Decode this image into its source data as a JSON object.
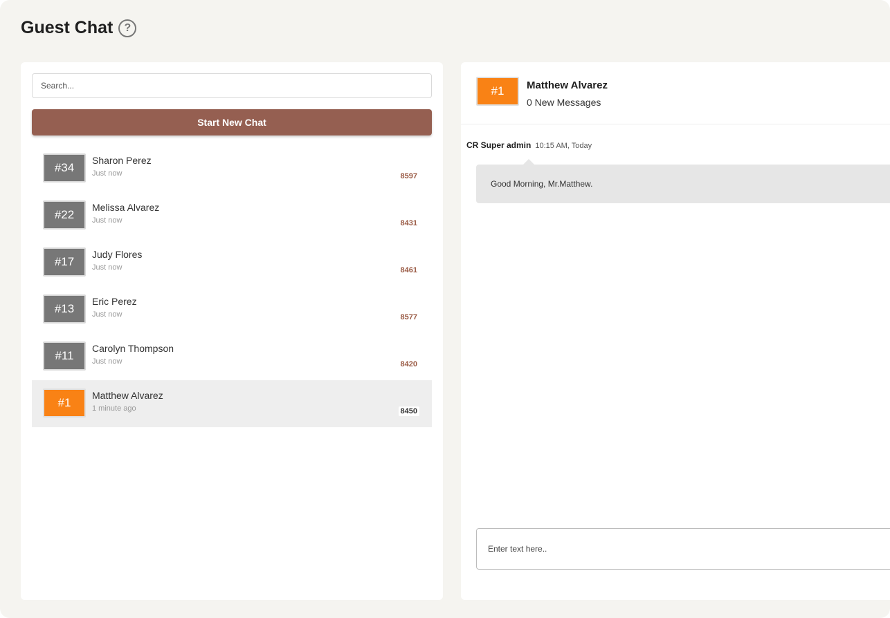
{
  "page": {
    "title": "Guest Chat",
    "help_icon": "question-circle-icon"
  },
  "sidebar": {
    "search_placeholder": "Search...",
    "new_chat_label": "Start New Chat",
    "chats": [
      {
        "room": "#34",
        "name": "Sharon Perez",
        "time": "Just now",
        "code": "8597",
        "active": false
      },
      {
        "room": "#22",
        "name": "Melissa Alvarez",
        "time": "Just now",
        "code": "8431",
        "active": false
      },
      {
        "room": "#17",
        "name": "Judy Flores",
        "time": "Just now",
        "code": "8461",
        "active": false
      },
      {
        "room": "#13",
        "name": "Eric Perez",
        "time": "Just now",
        "code": "8577",
        "active": false
      },
      {
        "room": "#11",
        "name": "Carolyn Thompson",
        "time": "Just now",
        "code": "8420",
        "active": false
      },
      {
        "room": "#1",
        "name": "Matthew Alvarez",
        "time": "1 minute ago",
        "code": "8450",
        "active": true
      }
    ]
  },
  "conversation": {
    "room": "#1",
    "name": "Matthew Alvarez",
    "new_messages": "0 New Messages",
    "messages": [
      {
        "sender": "CR Super admin",
        "time": "10:15 AM, Today",
        "text": "Good Morning, Mr.Matthew."
      }
    ],
    "input_placeholder": "Enter text here.."
  },
  "colors": {
    "background": "#f5f4f0",
    "accent_button": "#955f51",
    "active_badge": "#f98215",
    "inactive_badge": "#777777",
    "code_text": "#9a5a44"
  }
}
